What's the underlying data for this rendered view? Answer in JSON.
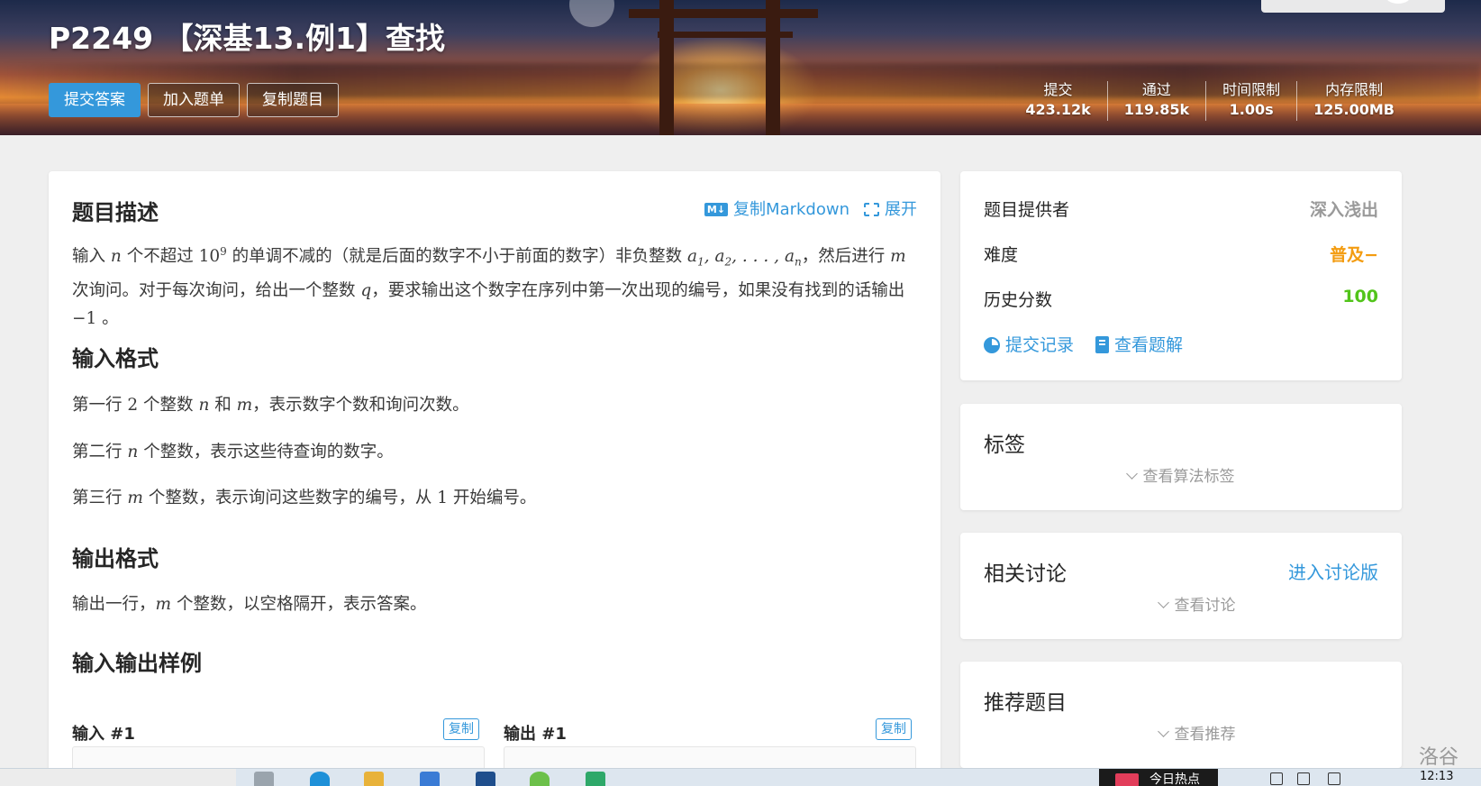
{
  "header": {
    "title": "P2249 【深基13.例1】查找",
    "buttons": {
      "submit": "提交答案",
      "add_to_list": "加入题单",
      "copy_problem": "复制题目"
    },
    "stats": [
      {
        "label": "提交",
        "value": "423.12k"
      },
      {
        "label": "通过",
        "value": "119.85k"
      },
      {
        "label": "时间限制",
        "value": "1.00s"
      },
      {
        "label": "内存限制",
        "value": "125.00MB"
      }
    ]
  },
  "problem": {
    "actions": {
      "copy_markdown": "复制Markdown",
      "expand": "展开",
      "md_badge": "M↓"
    },
    "description": {
      "title": "题目描述",
      "t1": "输入 ",
      "n": "n",
      "t2": " 个不超过 ",
      "pow_base": "10",
      "pow_exp": "9",
      "t3": " 的单调不减的（就是后面的数字不小于前面的数字）非负整数 ",
      "seq": "a",
      "sub1": "1",
      "comma1": ", ",
      "sub2": "2",
      "ellipsis": ", . . . , ",
      "subn": "n",
      "t4": "，然后进行 ",
      "m": "m",
      "t5": " 次询问。对于每次询问，给出一个整数 ",
      "q": "q",
      "t6": "，要求输出这个数字在序列中第一次出现的编号，如果没有找到的话输出 ",
      "neg1": "−1",
      "t7": " 。"
    },
    "input_format": {
      "title": "输入格式",
      "l1_a": "第一行 ",
      "l1_two": "2",
      "l1_b": " 个整数 ",
      "l1_n": "n",
      "l1_c": " 和 ",
      "l1_m": "m",
      "l1_d": "，表示数字个数和询问次数。",
      "l2_a": "第二行 ",
      "l2_n": "n",
      "l2_b": " 个整数，表示这些待查询的数字。",
      "l3_a": "第三行 ",
      "l3_m": "m",
      "l3_b": " 个整数，表示询问这些数字的编号，从 ",
      "l3_one": "1",
      "l3_c": " 开始编号。"
    },
    "output_format": {
      "title": "输出格式",
      "l1_a": "输出一行，",
      "l1_m": "m",
      "l1_b": " 个整数，以空格隔开，表示答案。"
    },
    "samples": {
      "title": "输入输出样例",
      "input_label": "输入 #1",
      "output_label": "输出 #1",
      "copy": "复制"
    }
  },
  "sidebar": {
    "info": {
      "provider_label": "题目提供者",
      "provider_value": "深入浅出",
      "difficulty_label": "难度",
      "difficulty_value": "普及−",
      "difficulty_color": "#f39c11",
      "history_label": "历史分数",
      "history_value": "100",
      "history_color": "#52c41a",
      "submission_record": "提交记录",
      "view_solution": "查看题解"
    },
    "tags": {
      "title": "标签",
      "more": "查看算法标签"
    },
    "discussion": {
      "title": "相关讨论",
      "enter": "进入讨论版",
      "more": "查看讨论"
    },
    "recommend": {
      "title": "推荐题目",
      "more": "查看推荐"
    }
  },
  "watermark": "洛谷",
  "taskbar": {
    "news": "今日热点",
    "clock": "12:13"
  }
}
